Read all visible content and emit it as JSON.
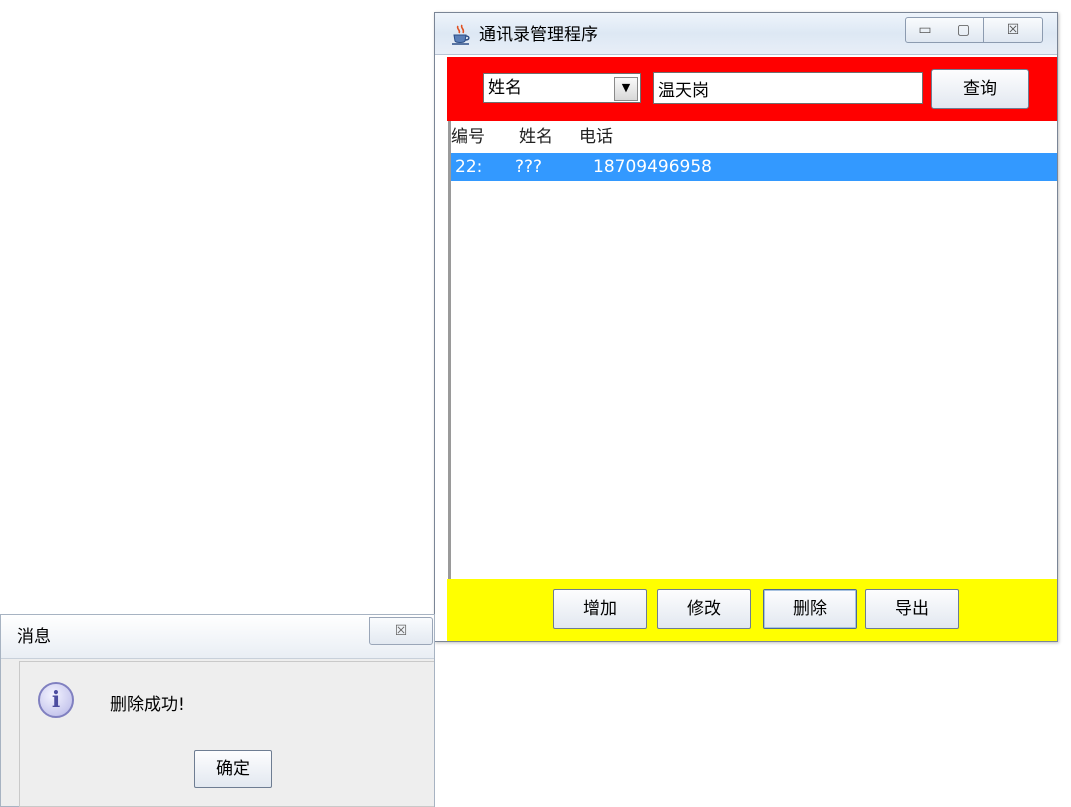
{
  "main_window": {
    "title": "通讯录管理程序",
    "app_icon": "java-cup-icon",
    "controls": {
      "minimize": "▭",
      "maximize": "▢",
      "close": "☒"
    }
  },
  "search": {
    "field_selected": "姓名",
    "query_value": "温天岗",
    "button_label": "查询"
  },
  "list": {
    "headers": [
      "编号",
      "姓名",
      "电话"
    ],
    "rows": [
      {
        "id": "22:",
        "name": "???",
        "phone": "18709496958",
        "selected": true
      }
    ]
  },
  "actions": {
    "add_label": "增加",
    "edit_label": "修改",
    "delete_label": "删除",
    "export_label": "导出"
  },
  "dialog": {
    "title": "消息",
    "close_glyph": "☒",
    "icon": "info-icon",
    "icon_glyph": "i",
    "message": "删除成功!",
    "ok_label": "确定"
  },
  "colors": {
    "search_bar": "#ff0000",
    "action_bar": "#ffff00",
    "selection": "#3399ff"
  }
}
